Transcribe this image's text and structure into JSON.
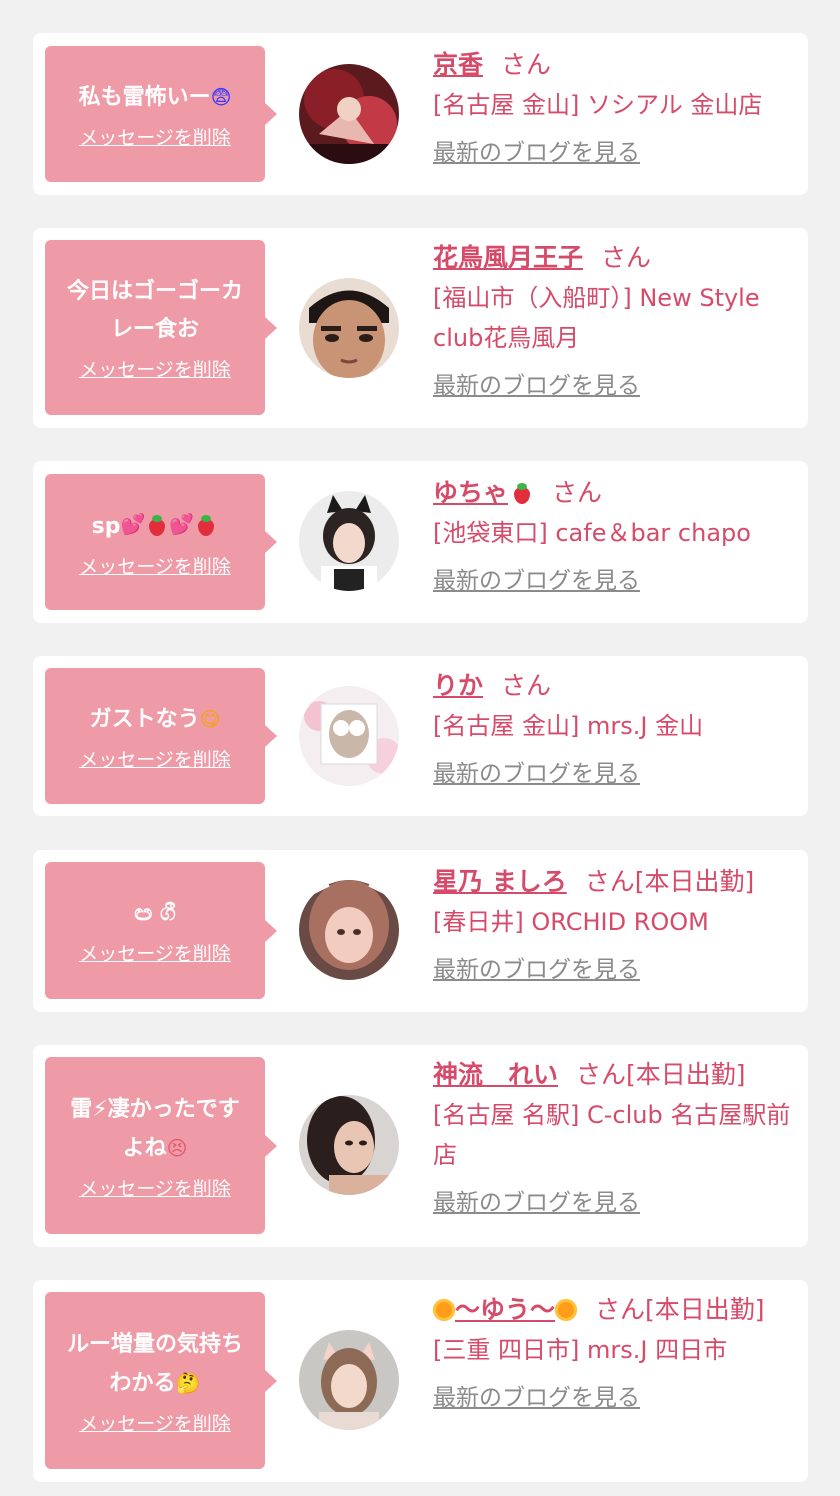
{
  "colors": {
    "accent": "#d64b6a",
    "bubble": "#ee9ba7",
    "link_gray": "#8b8b8b",
    "background": "#f1f1f1"
  },
  "cards": [
    {
      "message": "私も雷怖いー",
      "message_emoji": "😨",
      "delete_label": "メッセージを削除",
      "name": "京香",
      "honorific": "さん",
      "shop": "[名古屋 金山] ソシアル 金山店",
      "blog_label": "最新のブログを見る"
    },
    {
      "message": "今日はゴーゴーカレー食お",
      "delete_label": "メッセージを削除",
      "name": "花鳥風月王子",
      "honorific": "さん",
      "shop": "[福山市（入船町）] New Style club花鳥風月",
      "blog_label": "最新のブログを見る"
    },
    {
      "message": "sp💕🍓💕🍓",
      "delete_label": "メッセージを削除",
      "name": "ゆちゃ",
      "name_emoji": "🍓",
      "honorific": "さん",
      "shop": "[池袋東口] cafe＆bar chapo",
      "blog_label": "最新のブログを見る"
    },
    {
      "message": "ガストなう",
      "message_emoji": "😋",
      "delete_label": "メッセージを削除",
      "name": "りか",
      "honorific": "さん",
      "shop": "[名古屋 金山] mrs.J 金山",
      "blog_label": "最新のブログを見る"
    },
    {
      "message": "ඏ ගී",
      "delete_label": "メッセージを削除",
      "name": "星乃 ましろ",
      "honorific": "さん[本日出勤]",
      "shop": "[春日井] ORCHID ROOM",
      "blog_label": "最新のブログを見る"
    },
    {
      "message": "雷⚡凄かったですよね",
      "message_emoji": "😣",
      "delete_label": "メッセージを削除",
      "name": "神流　れい",
      "honorific": "さん[本日出勤]",
      "shop": "[名古屋 名駅] C-club 名古屋駅前店",
      "blog_label": "最新のブログを見る"
    },
    {
      "message": "ルー増量の気持ちわかる",
      "message_emoji": "🤔",
      "delete_label": "メッセージを削除",
      "name": "〜ゆう〜",
      "name_emoji": "🌼",
      "honorific": "さん[本日出勤]",
      "shop": "[三重 四日市] mrs.J 四日市",
      "blog_label": "最新のブログを見る"
    }
  ]
}
